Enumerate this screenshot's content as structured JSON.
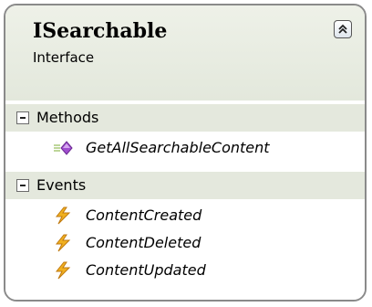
{
  "shape": {
    "title": "ISearchable",
    "subtitle": "Interface",
    "collapse_icon": "double-chevron-up-icon"
  },
  "sections": [
    {
      "label": "Methods",
      "toggle_icon": "collapse-minus-icon",
      "items": [
        {
          "label": "GetAllSearchableContent",
          "icon": "method-icon"
        }
      ]
    },
    {
      "label": "Events",
      "toggle_icon": "collapse-minus-icon",
      "items": [
        {
          "label": "ContentCreated",
          "icon": "event-lightning-icon"
        },
        {
          "label": "ContentDeleted",
          "icon": "event-lightning-icon"
        },
        {
          "label": "ContentUpdated",
          "icon": "event-lightning-icon"
        }
      ]
    }
  ],
  "colors": {
    "border": "#8a8a8a",
    "header_bg": "#e3e8dc",
    "section_bg": "#e4e8dd",
    "method_icon": "#a04ed0",
    "event_icon": "#f0b020"
  }
}
